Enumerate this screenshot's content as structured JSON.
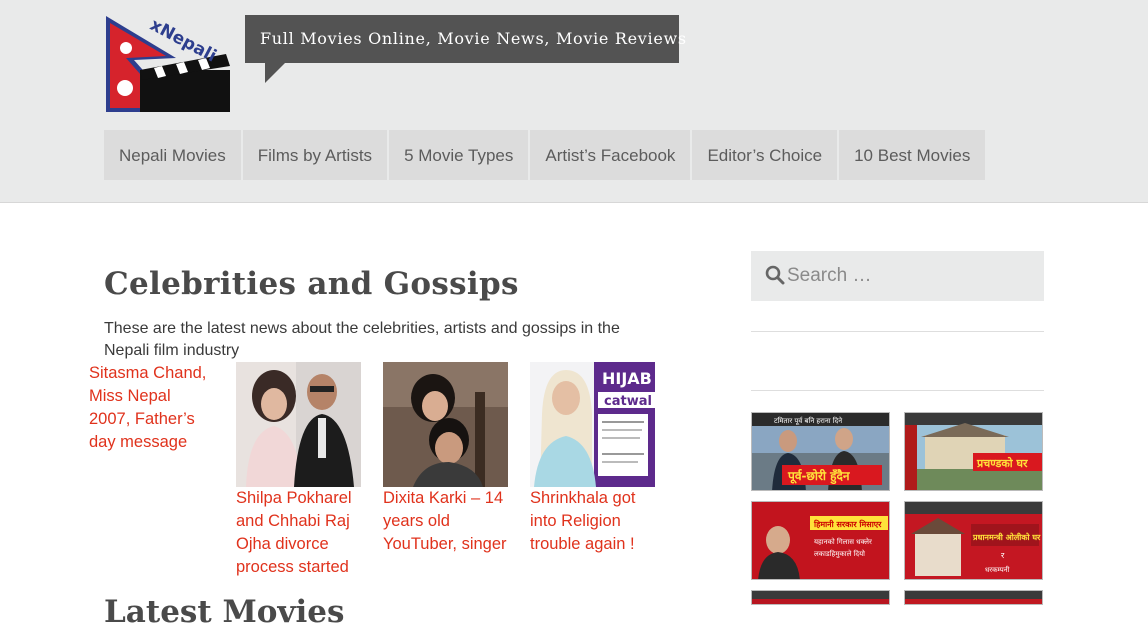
{
  "site": {
    "logo_text": "xNepali",
    "tagline": "Full Movies Online, Movie News, Movie Reviews"
  },
  "nav": {
    "items": [
      {
        "label": "Nepali Movies"
      },
      {
        "label": "Films by Artists"
      },
      {
        "label": "5 Movie Types"
      },
      {
        "label": "Artist’s Facebook"
      },
      {
        "label": "Editor’s Choice"
      },
      {
        "label": "10 Best Movies"
      }
    ]
  },
  "main": {
    "title": "Celebrities and Gossips",
    "intro": "These are the latest news about the celebrities, artists and gossips in the Nepali film industry",
    "posts": [
      {
        "title": "Sitasma Chand, Miss Nepal 2007, Father’s day message"
      },
      {
        "title": "Shilpa Pokharel and Chhabi Raj Ojha divorce process started"
      },
      {
        "title": "Dixita Karki – 14 years old YouTuber, singer"
      },
      {
        "title": "Shrinkhala got into Religion trouble again !",
        "thumb_text": "HIJAB",
        "thumb_subtext": "catwal"
      }
    ],
    "next_heading": "Latest Movies"
  },
  "sidebar": {
    "search_placeholder": "Search …",
    "thumbs": [
      {
        "caption": "पूर्व-छोरी हुँदैन",
        "top_text": "टमितार पूर्व बनि हराना दिने"
      },
      {
        "caption": "प्रचण्डको घर",
        "top_text": "प्रचण्डको घर"
      },
      {
        "caption": "हिमानी सरकार मिसाएर",
        "sub": "यहानको गिलास धक्लेर",
        "sub2": "लकाडहिमुकाले दियो"
      },
      {
        "caption": "प्रधानमन्त्री ओलीको घर",
        "sub": "र",
        "sub2": "धरकम्पनी"
      },
      {
        "caption": ""
      },
      {
        "caption": ""
      }
    ]
  },
  "colors": {
    "link": "#e0321c",
    "header_bg": "#e9eaea",
    "nav_bg": "#dcdcdc",
    "tagline_bg": "#535353"
  }
}
